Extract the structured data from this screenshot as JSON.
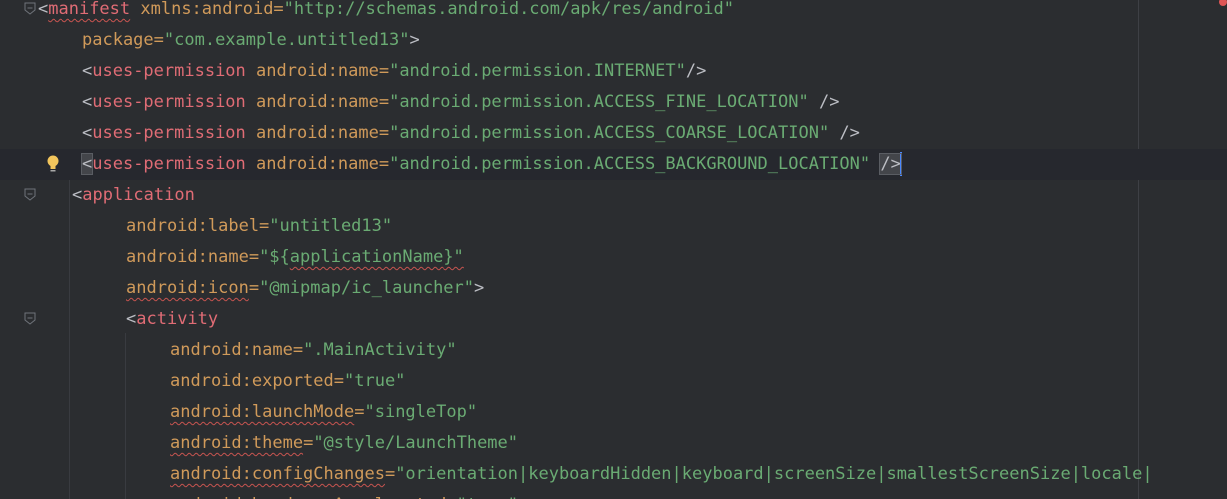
{
  "editor": {
    "lines": [
      {
        "segments": [
          {
            "t": "<",
            "c": "punct"
          },
          {
            "t": "manifest",
            "c": "tagname squig"
          },
          {
            "t": " xmlns:android=",
            "c": "attr2"
          },
          {
            "t": "\"http://schemas.android.com/apk/res/android\"",
            "c": "str"
          }
        ]
      },
      {
        "segments": [
          {
            "t": "package=",
            "c": "attr2"
          },
          {
            "t": "\"com.example.untitled13\"",
            "c": "str"
          },
          {
            "t": ">",
            "c": "punct"
          }
        ]
      },
      {
        "segments": [
          {
            "t": "<",
            "c": "punct"
          },
          {
            "t": "uses-permission",
            "c": "tagname"
          },
          {
            "t": " android:name=",
            "c": "attr2"
          },
          {
            "t": "\"android.permission.INTERNET\"",
            "c": "str"
          },
          {
            "t": "/>",
            "c": "punct"
          }
        ]
      },
      {
        "segments": [
          {
            "t": "<",
            "c": "punct"
          },
          {
            "t": "uses-permission",
            "c": "tagname"
          },
          {
            "t": " android:name=",
            "c": "attr2"
          },
          {
            "t": "\"android.permission.ACCESS_FINE_LOCATION\"",
            "c": "str"
          },
          {
            "t": " />",
            "c": "punct"
          }
        ]
      },
      {
        "segments": [
          {
            "t": "<",
            "c": "punct"
          },
          {
            "t": "uses-permission",
            "c": "tagname"
          },
          {
            "t": " android:name=",
            "c": "attr2"
          },
          {
            "t": "\"android.permission.ACCESS_COARSE_LOCATION\"",
            "c": "str"
          },
          {
            "t": " />",
            "c": "punct"
          }
        ]
      },
      {
        "segments": [
          {
            "t": "<",
            "c": "punct hl-bracket"
          },
          {
            "t": "uses-permission",
            "c": "tagname"
          },
          {
            "t": " android:name=",
            "c": "attr2"
          },
          {
            "t": "\"android.permission.ACCESS_BACKGROUND_LOCATION\"",
            "c": "str"
          },
          {
            "t": " ",
            "c": "punct"
          },
          {
            "t": "/>",
            "c": "punct hl-bracket"
          }
        ]
      },
      {
        "segments": [
          {
            "t": "<",
            "c": "punct"
          },
          {
            "t": "application",
            "c": "tagname"
          }
        ]
      },
      {
        "segments": [
          {
            "t": "android:label=",
            "c": "attr2"
          },
          {
            "t": "\"untitled13\"",
            "c": "str"
          }
        ]
      },
      {
        "segments": [
          {
            "t": "android:name=",
            "c": "attr2"
          },
          {
            "t": "\"${",
            "c": "str"
          },
          {
            "t": "applicationName",
            "c": "str squig"
          },
          {
            "t": "}\"",
            "c": "str squig"
          }
        ]
      },
      {
        "segments": [
          {
            "t": "android:icon",
            "c": "attr2 squig"
          },
          {
            "t": "=",
            "c": "attr2"
          },
          {
            "t": "\"@mipmap/ic_launcher\"",
            "c": "str"
          },
          {
            "t": ">",
            "c": "punct"
          }
        ]
      },
      {
        "segments": [
          {
            "t": "<",
            "c": "punct"
          },
          {
            "t": "activity",
            "c": "tagname"
          }
        ]
      },
      {
        "segments": [
          {
            "t": "android:name=",
            "c": "attr2"
          },
          {
            "t": "\".MainActivity\"",
            "c": "str"
          }
        ]
      },
      {
        "segments": [
          {
            "t": "android:exported=",
            "c": "attr2"
          },
          {
            "t": "\"true\"",
            "c": "str"
          }
        ]
      },
      {
        "segments": [
          {
            "t": "android:launchMode",
            "c": "attr2 squig"
          },
          {
            "t": "=",
            "c": "attr2"
          },
          {
            "t": "\"singleTop\"",
            "c": "str"
          }
        ]
      },
      {
        "segments": [
          {
            "t": "android:theme",
            "c": "attr2 squig"
          },
          {
            "t": "=",
            "c": "attr2"
          },
          {
            "t": "\"@style/LaunchTheme\"",
            "c": "str"
          }
        ]
      },
      {
        "segments": [
          {
            "t": "android:configChanges",
            "c": "attr2 squig"
          },
          {
            "t": "=",
            "c": "attr2"
          },
          {
            "t": "\"orientation|keyboardHidden|keyboard|screenSize|smallestScreenSize|locale|",
            "c": "str"
          }
        ]
      },
      {
        "segments": [
          {
            "t": "android:hardwareAccelerated=",
            "c": "attr2"
          },
          {
            "t": "\"true\"",
            "c": "str"
          }
        ]
      }
    ]
  },
  "gutter_icons": {
    "fold": "fold-arrow-icon",
    "bulb": "lightbulb-icon",
    "error": "error-indicator-icon"
  },
  "colors": {
    "background": "#2b2d30",
    "tag": "#e06c75",
    "attribute": "#d09a5a",
    "string": "#6aab73",
    "caret": "#4a88ff"
  }
}
